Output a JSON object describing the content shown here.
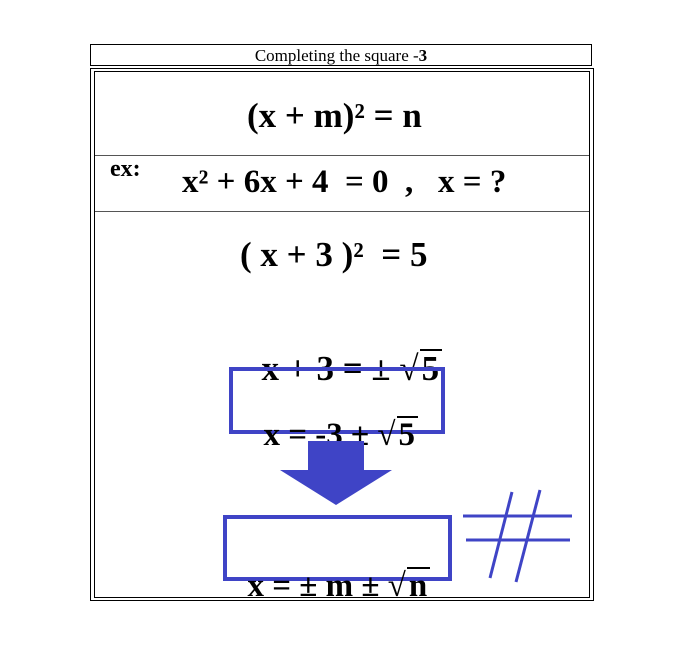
{
  "title": {
    "text": "Completing the square",
    "dash": " -",
    "number": "3"
  },
  "formula": {
    "text": "(x + m)² = n"
  },
  "example": {
    "label": "ex:",
    "equation": "x² + 6x + 4  = 0  ,   x = ?"
  },
  "steps": {
    "step1": "( x + 3 )²  = 5",
    "step2_lhs": "x + 3 = ± ",
    "step2_rad": "5",
    "step3_lhs": "x = -3 ± ",
    "step3_rad": "5"
  },
  "general": {
    "lhs": "x = ± m ± ",
    "rad": "n"
  },
  "colors": {
    "accent": "#3f44c6",
    "text": "#000000",
    "background": "#ffffff"
  },
  "icons": [
    "down-arrow-icon",
    "hashtag-icon"
  ]
}
